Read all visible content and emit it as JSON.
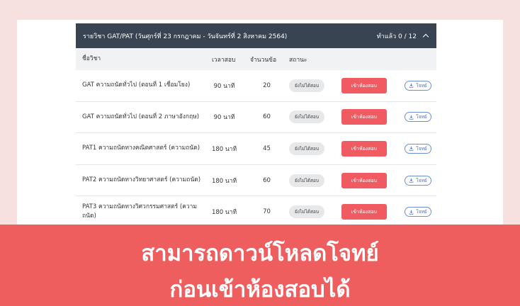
{
  "header": {
    "title": "รายวิชา GAT/PAT (วันศุกร์ที่ 23 กรกฎาคม - วันจันทร์ที่ 2 สิงหาคม 2564)",
    "progress": "ทำแล้ว 0 / 12"
  },
  "columns": {
    "name": "ชื่อวิชา",
    "time": "เวลาสอบ",
    "count": "จำนวนข้อ",
    "status": "สถานะ"
  },
  "rows": [
    {
      "name": "GAT ความถนัดทั่วไป (ตอนที่ 1 เชื่อมโยง)",
      "time": "90 นาที",
      "count": "20",
      "status": "ยังไม่ได้สอบ",
      "enter": "เข้าห้องสอบ",
      "download": "โจทย์"
    },
    {
      "name": "GAT ความถนัดทั่วไป (ตอนที่ 2 ภาษาอังกฤษ)",
      "time": "90 นาที",
      "count": "60",
      "status": "ยังไม่ได้สอบ",
      "enter": "เข้าห้องสอบ",
      "download": "โจทย์"
    },
    {
      "name": "PAT1 ความถนัดทางคณิตศาสตร์ (ความถนัด)",
      "time": "180 นาที",
      "count": "45",
      "status": "ยังไม่ได้สอบ",
      "enter": "เข้าห้องสอบ",
      "download": "โจทย์"
    },
    {
      "name": "PAT2 ความถนัดทางวิทยาศาสตร์ (ความถนัด)",
      "time": "180 นาที",
      "count": "60",
      "status": "ยังไม่ได้สอบ",
      "enter": "เข้าห้องสอบ",
      "download": "โจทย์"
    },
    {
      "name": "PAT3 ความถนัดทางวิศวกรรมศาสตร์ (ความถนัด)",
      "time": "180 นาที",
      "count": "70",
      "status": "ยังไม่ได้สอบ",
      "enter": "เข้าห้องสอบ",
      "download": "โจทย์"
    }
  ],
  "banner": {
    "line1": "สามารถดาวน์โหลดโจทย์",
    "line2": "ก่อนเข้าห้องสอบได้"
  },
  "colors": {
    "header_bg": "#394452",
    "enter_button": "#f05b61",
    "banner_bg": "#ef5e5f",
    "download_border": "#6c8fd0"
  },
  "icons": {
    "collapse": "chevron-up-icon",
    "download": "download-icon"
  }
}
